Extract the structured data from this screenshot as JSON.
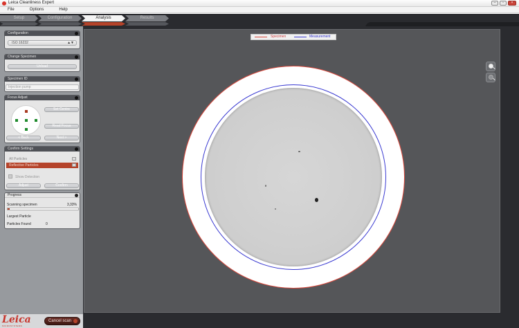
{
  "window": {
    "title": "Leica Cleanliness Expert",
    "btn_min": "–",
    "btn_max": "▫",
    "btn_close": "×"
  },
  "menu": [
    "File",
    "Options",
    "Help"
  ],
  "steps": [
    "Setup",
    "Configuration",
    "Analysis",
    "Results"
  ],
  "active_step": "Analysis",
  "configuration": {
    "title": "Configuration",
    "selected": "ISO 16232",
    "spinner": "▲▼"
  },
  "change_specimen": {
    "title": "Change Specimen",
    "button": "Unload"
  },
  "specimen_id": {
    "title": "Specimen ID",
    "value": "Injection pump"
  },
  "focus_adjust": {
    "title": "Focus Adjust",
    "set_centre": "Set Centre",
    "read_focus": "Read Focus",
    "back": "< Back",
    "next": "Next >"
  },
  "confirm_settings": {
    "title": "Confirm Settings",
    "rows": [
      {
        "label": "All Particles"
      },
      {
        "label": "Reflective Particles"
      }
    ],
    "show_detection": "Show Detection",
    "adjust": "Adjust",
    "confirm": "Confirm"
  },
  "progress": {
    "title": "Progress",
    "scanning_label": "Scanning specimen",
    "scanning_value": "3,33%",
    "fraction": 0.0333,
    "largest_particle_label": "Largest Particle",
    "particles_found_label": "Particles Found",
    "particles_found_value": "0"
  },
  "legend": {
    "specimen": "Specimen",
    "measurement": "Measurement",
    "specimen_color": "#d9473b",
    "measurement_color": "#3a3ad1"
  },
  "bottom": {
    "brand": "Leica",
    "brand_sub": "MICROSYSTEMS",
    "cancel": "Cancel scan"
  },
  "colors": {
    "accent": "#b5432a",
    "focus_point": "#1e8a2c"
  }
}
